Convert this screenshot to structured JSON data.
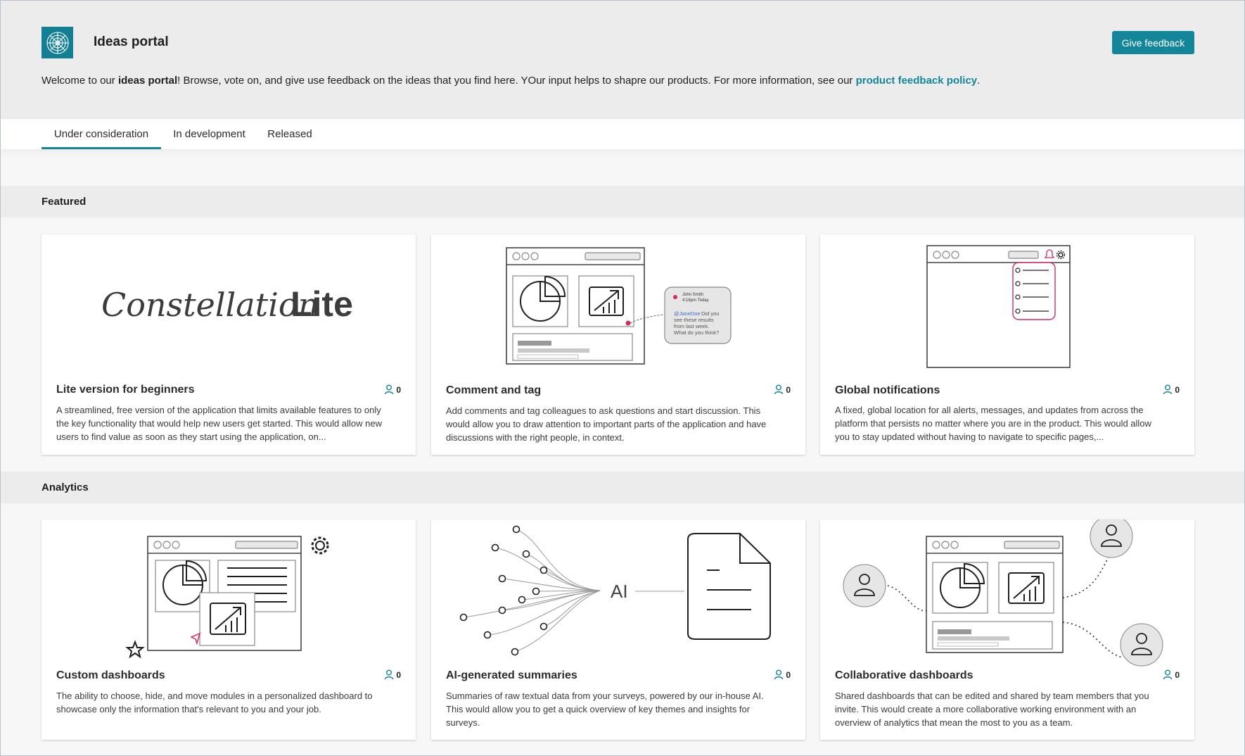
{
  "app": {
    "title": "Ideas portal",
    "logo_icon": "radar-icon",
    "accent": "#13869a"
  },
  "header": {
    "feedback_button": "Give feedback",
    "welcome_prefix": "Welcome to our ",
    "welcome_bold": "ideas portal",
    "welcome_middle": "! Browse, vote on, and give use feedback on the ideas that you find here. YOur input helps to shapre our products. For more information, see our ",
    "welcome_link": "product feedback policy",
    "welcome_suffix": "."
  },
  "tabs": [
    {
      "label": "Under consideration",
      "active": true
    },
    {
      "label": "In development",
      "active": false
    },
    {
      "label": "Released",
      "active": false
    }
  ],
  "sections": [
    {
      "title": "Featured",
      "cards": [
        {
          "title": "Lite version for beginners",
          "votes": "0",
          "illustration": "constellation-lite-logo",
          "logo_text_script": "Constellation",
          "logo_text_bold": "Lite",
          "description": "A streamlined, free version of the application that limits available features to only the key functionality that would help new users get started. This would allow new users to find value as soon as they start using the application, on..."
        },
        {
          "title": "Comment and tag",
          "votes": "0",
          "illustration": "comment-window",
          "comment": {
            "author": "John Smith",
            "time": "4:18pm Today",
            "mention": "@JaneDoe",
            "text_1": "Did you",
            "text_2": "see these results",
            "text_3": "from last week.",
            "text_4": "What do you think?"
          },
          "description": "Add comments and tag colleagues to ask questions and start discussion. This would allow you to draw attention to important parts of the application and have discussions with the right people, in context."
        },
        {
          "title": "Global notifications",
          "votes": "0",
          "illustration": "notifications-window",
          "description": "A fixed, global location for all alerts, messages, and updates from across the platform that persists no matter where you are in the product. This would allow you to stay updated without having to navigate to specific pages,..."
        }
      ]
    },
    {
      "title": "Analytics",
      "cards": [
        {
          "title": "Custom dashboards",
          "votes": "0",
          "illustration": "custom-dashboard",
          "description": "The ability to choose, hide, and move modules in a personalized dashboard to showcase only the information that's relevant to you and your job."
        },
        {
          "title": "AI-generated summaries",
          "votes": "0",
          "illustration": "ai-summary",
          "ai_label": "AI",
          "description": "Summaries of raw textual data from your surveys, powered by our in-house AI. This would allow you to get a quick overview of key themes and insights for surveys."
        },
        {
          "title": "Collaborative dashboards",
          "votes": "0",
          "illustration": "collaborative-dashboard",
          "description": "Shared dashboards that can be edited and shared by team members that you invite. This would create a more collaborative working environment with an overview of analytics that mean the most to you as a team."
        }
      ]
    }
  ]
}
